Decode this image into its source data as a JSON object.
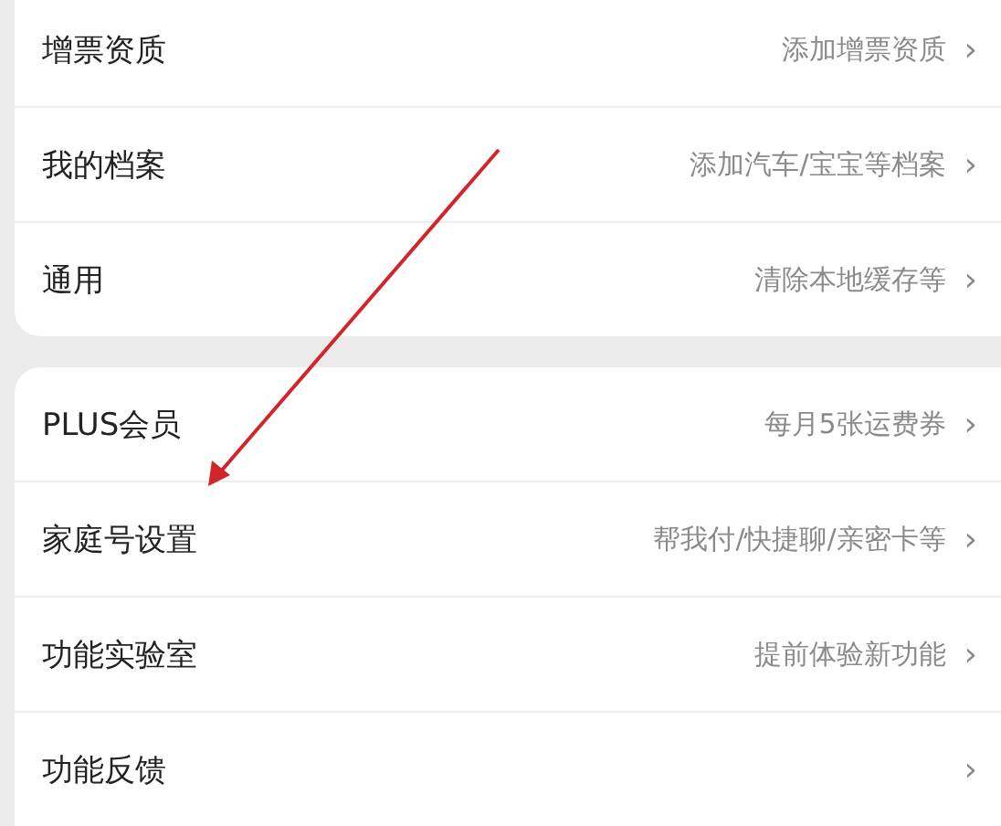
{
  "groups": [
    {
      "items": [
        {
          "label": "增票资质",
          "value": "添加增票资质",
          "chevron": "›"
        },
        {
          "label": "我的档案",
          "value": "添加汽车/宝宝等档案",
          "chevron": "›"
        },
        {
          "label": "通用",
          "value": "清除本地缓存等",
          "chevron": "›"
        }
      ]
    },
    {
      "items": [
        {
          "label": "PLUS会员",
          "value": "每月5张运费券",
          "chevron": "›"
        },
        {
          "label": "家庭号设置",
          "value": "帮我付/快捷聊/亲密卡等",
          "chevron": "›"
        },
        {
          "label": "功能实验室",
          "value": "提前体验新功能",
          "chevron": "›"
        },
        {
          "label": "功能反馈",
          "chevron": "›"
        }
      ]
    }
  ]
}
